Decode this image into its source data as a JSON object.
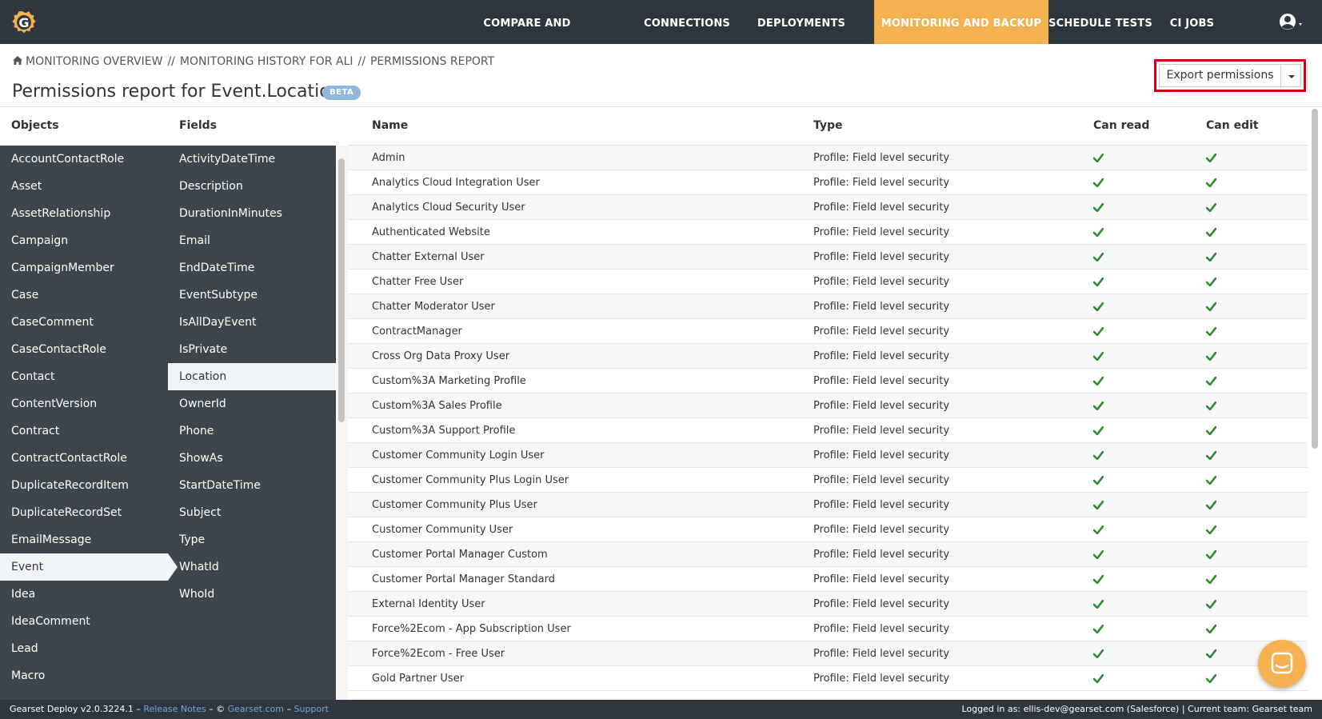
{
  "nav": {
    "items": [
      {
        "label": "COMPARE AND DEPLOY",
        "active": false
      },
      {
        "label": "CONNECTIONS",
        "active": false
      },
      {
        "label": "DEPLOYMENTS",
        "active": false
      },
      {
        "label": "MONITORING AND BACKUP",
        "active": true
      },
      {
        "label": "SCHEDULE TESTS",
        "active": false
      },
      {
        "label": "CI JOBS",
        "active": false
      }
    ],
    "user_icon": "user-circle-icon",
    "logo_icon": "gearset-logo-icon"
  },
  "breadcrumb": {
    "items": [
      "MONITORING OVERVIEW",
      "MONITORING HISTORY FOR ALI",
      "PERMISSIONS REPORT"
    ],
    "separator": "//"
  },
  "header": {
    "title": "Permissions report for Event.Location",
    "badge": "BETA",
    "export_label": "Export permissions"
  },
  "columns": {
    "objects": "Objects",
    "fields": "Fields",
    "name": "Name",
    "type": "Type",
    "can_read": "Can read",
    "can_edit": "Can edit"
  },
  "objects": [
    "AccountContactRole",
    "Asset",
    "AssetRelationship",
    "Campaign",
    "CampaignMember",
    "Case",
    "CaseComment",
    "CaseContactRole",
    "Contact",
    "ContentVersion",
    "Contract",
    "ContractContactRole",
    "DuplicateRecordItem",
    "DuplicateRecordSet",
    "EmailMessage",
    "Event",
    "Idea",
    "IdeaComment",
    "Lead",
    "Macro"
  ],
  "selected_object": "Event",
  "fields": [
    "ActivityDateTime",
    "Description",
    "DurationInMinutes",
    "Email",
    "EndDateTime",
    "EventSubtype",
    "IsAllDayEvent",
    "IsPrivate",
    "Location",
    "OwnerId",
    "Phone",
    "ShowAs",
    "StartDateTime",
    "Subject",
    "Type",
    "WhatId",
    "WhoId"
  ],
  "selected_field": "Location",
  "permissions": [
    {
      "name": "Admin",
      "type": "Profile: Field level security",
      "read": true,
      "edit": true
    },
    {
      "name": "Analytics Cloud Integration User",
      "type": "Profile: Field level security",
      "read": true,
      "edit": true
    },
    {
      "name": "Analytics Cloud Security User",
      "type": "Profile: Field level security",
      "read": true,
      "edit": true
    },
    {
      "name": "Authenticated Website",
      "type": "Profile: Field level security",
      "read": true,
      "edit": true
    },
    {
      "name": "Chatter External User",
      "type": "Profile: Field level security",
      "read": true,
      "edit": true
    },
    {
      "name": "Chatter Free User",
      "type": "Profile: Field level security",
      "read": true,
      "edit": true
    },
    {
      "name": "Chatter Moderator User",
      "type": "Profile: Field level security",
      "read": true,
      "edit": true
    },
    {
      "name": "ContractManager",
      "type": "Profile: Field level security",
      "read": true,
      "edit": true
    },
    {
      "name": "Cross Org Data Proxy User",
      "type": "Profile: Field level security",
      "read": true,
      "edit": true
    },
    {
      "name": "Custom%3A Marketing Profile",
      "type": "Profile: Field level security",
      "read": true,
      "edit": true
    },
    {
      "name": "Custom%3A Sales Profile",
      "type": "Profile: Field level security",
      "read": true,
      "edit": true
    },
    {
      "name": "Custom%3A Support Profile",
      "type": "Profile: Field level security",
      "read": true,
      "edit": true
    },
    {
      "name": "Customer Community Login User",
      "type": "Profile: Field level security",
      "read": true,
      "edit": true
    },
    {
      "name": "Customer Community Plus Login User",
      "type": "Profile: Field level security",
      "read": true,
      "edit": true
    },
    {
      "name": "Customer Community Plus User",
      "type": "Profile: Field level security",
      "read": true,
      "edit": true
    },
    {
      "name": "Customer Community User",
      "type": "Profile: Field level security",
      "read": true,
      "edit": true
    },
    {
      "name": "Customer Portal Manager Custom",
      "type": "Profile: Field level security",
      "read": true,
      "edit": true
    },
    {
      "name": "Customer Portal Manager Standard",
      "type": "Profile: Field level security",
      "read": true,
      "edit": true
    },
    {
      "name": "External Identity User",
      "type": "Profile: Field level security",
      "read": true,
      "edit": true
    },
    {
      "name": "Force%2Ecom - App Subscription User",
      "type": "Profile: Field level security",
      "read": true,
      "edit": true
    },
    {
      "name": "Force%2Ecom - Free User",
      "type": "Profile: Field level security",
      "read": true,
      "edit": true
    },
    {
      "name": "Gold Partner User",
      "type": "Profile: Field level security",
      "read": true,
      "edit": true
    }
  ],
  "footer": {
    "version": "Gearset Deploy v2.0.3224.1",
    "dash": "–",
    "release_notes": "Release Notes",
    "copyright": "©",
    "site": "Gearset.com",
    "support": "Support",
    "logged_in": "Logged in as: ellis-dev@gearset.com (Salesforce) | Current team: Gearset team"
  },
  "colors": {
    "nav_bg": "#2e3740",
    "accent": "#f5b14f",
    "side_bg": "#3d454d",
    "check": "#2e8b2e",
    "highlight": "#d0021b"
  }
}
